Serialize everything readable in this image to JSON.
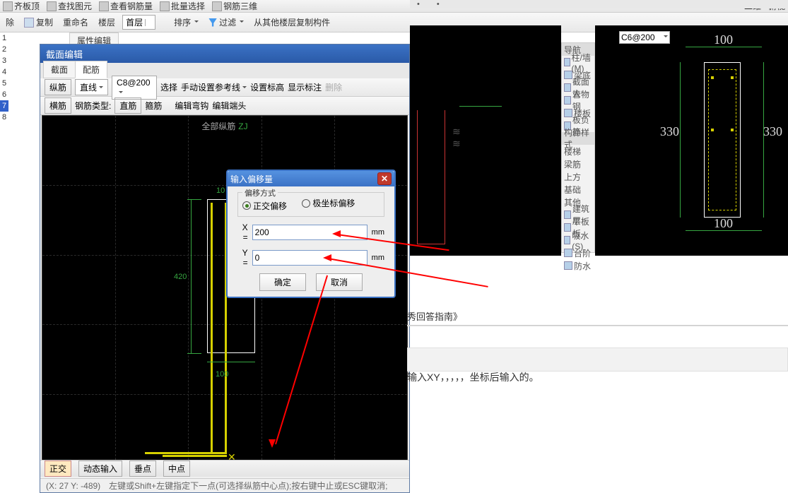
{
  "top_toolbar": {
    "items": [
      "齐板顶",
      "查找图元",
      "查看钢筋量",
      "批量选择",
      "钢筋三维",
      "二维",
      "俯视"
    ]
  },
  "toolbar2": {
    "del": "除",
    "copy": "复制",
    "rename": "重命名",
    "floor_label": "楼层",
    "floor_value": "首层",
    "sort": "排序",
    "filter": "过滤",
    "copy_from": "从其他楼层复制构件"
  },
  "prop_tab": "属性编辑",
  "left_list": [
    "1",
    "2",
    "3",
    "4",
    "5",
    "6",
    "7",
    "8"
  ],
  "jm": {
    "title": "截面编辑",
    "tabs": {
      "section": "截面",
      "rebar": "配筋"
    },
    "tb1": {
      "zongjin": "纵筋",
      "line": "直线",
      "spec": "C8@200",
      "select": "选择",
      "manual": "手动设置参考线",
      "set_elevation": "设置标高",
      "show_mark": "显示标注",
      "remove": "删除"
    },
    "tb2": {
      "hengjin": "横筋",
      "rebar_type": "钢筋类型:",
      "straight": "直筋",
      "stirrup": "箍筋",
      "edit_hook": "编辑弯钩",
      "edit_end": "编辑端头"
    },
    "canvas_title": {
      "w": "全部纵筋",
      "g": "ZJ"
    },
    "dims": {
      "d420": "420",
      "d100": "100",
      "d10": "10"
    }
  },
  "offset": {
    "title": "输入偏移量",
    "mode_label": "偏移方式",
    "ortho": "正交偏移",
    "polar": "极坐标偏移",
    "x_label": "X =",
    "y_label": "Y =",
    "x_val": "200",
    "y_val": "0",
    "unit": "mm",
    "ok": "确定",
    "cancel": "取消"
  },
  "status": {
    "ortho": "正交",
    "dyn": "动态输入",
    "perp": "垂点",
    "mid": "中点",
    "coord": "(X: 27 Y: -489)",
    "hint": "左键或Shift+左键指定下一点(可选择纵筋中心点);按右键中止或ESC键取消;"
  },
  "right": {
    "spec": "C6@200",
    "top100": "100",
    "mid330l": "330",
    "mid330r": "330",
    "bot100": "100",
    "panel_header": "导航",
    "panel_items": [
      "柱/墙(M)",
      "梁底",
      "截面人",
      "管物钢",
      "楼板",
      "板负筋"
    ],
    "panel_group": "构件样式",
    "panel_items2": [
      "楼梯",
      "梁筋",
      "上方",
      "基础",
      "其他"
    ],
    "panel_items3": [
      "建筑层",
      "平板板",
      "吸水(S)",
      "台阶",
      "防水"
    ]
  },
  "guide": "秀回答指南》",
  "answer": "输入XY，，，，，坐标后输入的。"
}
